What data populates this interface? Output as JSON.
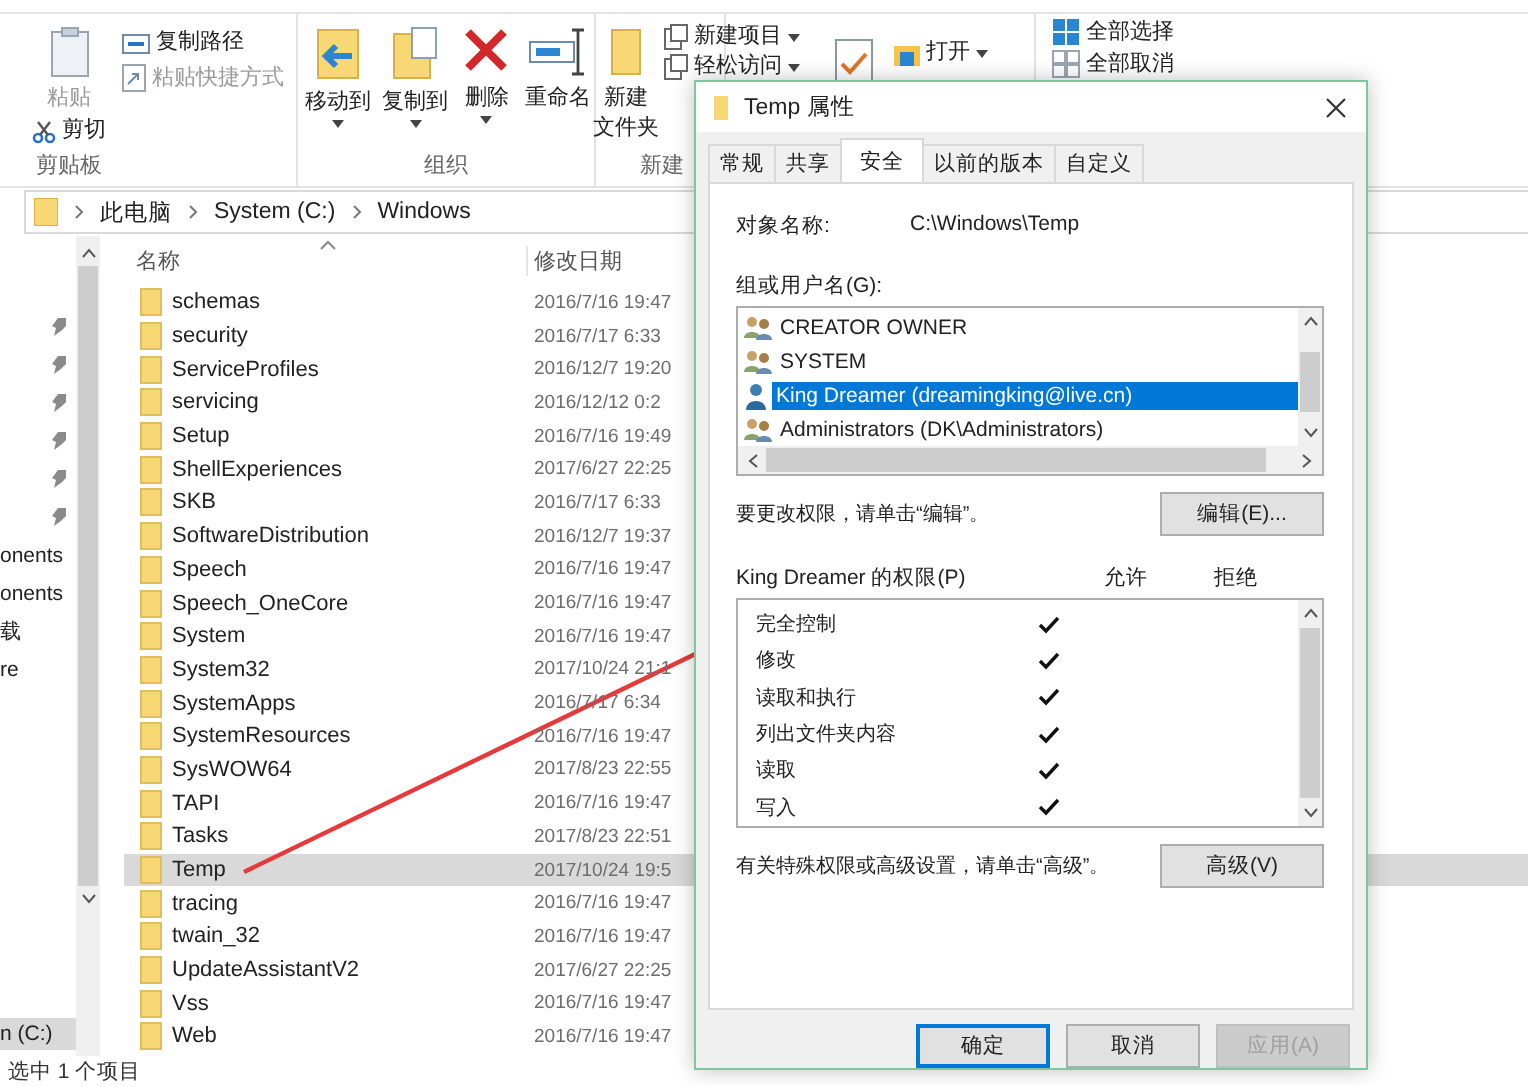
{
  "ribbon": {
    "clipboard": {
      "label": "剪贴板",
      "items": [
        {
          "label": "粘贴",
          "disabled": true
        },
        {
          "label": "剪切",
          "disabled": false
        },
        {
          "label": "复制路径",
          "disabled": false
        },
        {
          "label": "粘贴快捷方式",
          "disabled": true
        }
      ]
    },
    "organize": {
      "label": "组织",
      "items": [
        {
          "label": "移动到",
          "dropdown": true
        },
        {
          "label": "复制到",
          "dropdown": true
        },
        {
          "label": "删除",
          "dropdown": true
        },
        {
          "label": "重命名",
          "dropdown": false
        }
      ]
    },
    "new": {
      "label": "新建",
      "folder": [
        "新建",
        "文件夹"
      ],
      "items": [
        {
          "label": "新建项目"
        },
        {
          "label": "轻松访问"
        }
      ]
    },
    "open": {
      "label": "打开"
    },
    "select": {
      "items": [
        {
          "label": "全部选择"
        },
        {
          "label": "全部取消"
        }
      ]
    }
  },
  "address": {
    "path": [
      "此电脑",
      "System (C:)",
      "Windows"
    ]
  },
  "nav": {
    "items": [
      {
        "kind": "pin"
      },
      {
        "kind": "pin"
      },
      {
        "kind": "pin"
      },
      {
        "kind": "pin"
      },
      {
        "kind": "pin"
      },
      {
        "kind": "pin"
      },
      {
        "kind": "text",
        "label": "onents",
        "selected": false
      },
      {
        "kind": "text",
        "label": "onents",
        "selected": false
      },
      {
        "kind": "text",
        "label": "载",
        "selected": false
      },
      {
        "kind": "text",
        "label": "re",
        "selected": false
      },
      {
        "kind": "text",
        "label": "n (C:)",
        "selected": true
      }
    ]
  },
  "file_list": {
    "columns": [
      "名称",
      "修改日期"
    ],
    "rows": [
      {
        "name": "schemas",
        "modified": "2016/7/16 19:47",
        "selected": false
      },
      {
        "name": "security",
        "modified": "2016/7/17 6:33",
        "selected": false
      },
      {
        "name": "ServiceProfiles",
        "modified": "2016/12/7 19:20",
        "selected": false
      },
      {
        "name": "servicing",
        "modified": "2016/12/12 0:2",
        "selected": false
      },
      {
        "name": "Setup",
        "modified": "2016/7/16 19:49",
        "selected": false
      },
      {
        "name": "ShellExperiences",
        "modified": "2017/6/27 22:25",
        "selected": false
      },
      {
        "name": "SKB",
        "modified": "2016/7/17 6:33",
        "selected": false
      },
      {
        "name": "SoftwareDistribution",
        "modified": "2016/12/7 19:37",
        "selected": false
      },
      {
        "name": "Speech",
        "modified": "2016/7/16 19:47",
        "selected": false
      },
      {
        "name": "Speech_OneCore",
        "modified": "2016/7/16 19:47",
        "selected": false
      },
      {
        "name": "System",
        "modified": "2016/7/16 19:47",
        "selected": false
      },
      {
        "name": "System32",
        "modified": "2017/10/24 21:1",
        "selected": false
      },
      {
        "name": "SystemApps",
        "modified": "2016/7/17 6:34",
        "selected": false
      },
      {
        "name": "SystemResources",
        "modified": "2016/7/16 19:47",
        "selected": false
      },
      {
        "name": "SysWOW64",
        "modified": "2017/8/23 22:55",
        "selected": false
      },
      {
        "name": "TAPI",
        "modified": "2016/7/16 19:47",
        "selected": false
      },
      {
        "name": "Tasks",
        "modified": "2017/8/23 22:51",
        "selected": false
      },
      {
        "name": "Temp",
        "modified": "2017/10/24 19:5",
        "selected": true
      },
      {
        "name": "tracing",
        "modified": "2016/7/16 19:47",
        "selected": false
      },
      {
        "name": "twain_32",
        "modified": "2016/7/16 19:47",
        "selected": false
      },
      {
        "name": "UpdateAssistantV2",
        "modified": "2017/6/27 22:25",
        "selected": false
      },
      {
        "name": "Vss",
        "modified": "2016/7/16 19:47",
        "selected": false
      },
      {
        "name": "Web",
        "modified": "2016/7/16 19:47",
        "selected": false
      }
    ]
  },
  "status_bar": "选中 1 个项目",
  "dialog": {
    "title": "Temp 属性",
    "tabs": [
      {
        "label": "常规",
        "selected": false
      },
      {
        "label": "共享",
        "selected": false
      },
      {
        "label": "安全",
        "selected": true
      },
      {
        "label": "以前的版本",
        "selected": false
      },
      {
        "label": "自定义",
        "selected": false
      }
    ],
    "object_label": "对象名称:",
    "object_name": "C:\\Windows\\Temp",
    "groups_label": "组或用户名(G):",
    "groups": [
      {
        "name": "CREATOR OWNER",
        "kind": "group",
        "selected": false
      },
      {
        "name": "SYSTEM",
        "kind": "group",
        "selected": false
      },
      {
        "name": "King Dreamer (dreamingking@live.cn)",
        "kind": "user",
        "selected": true
      },
      {
        "name": "Administrators (DK\\Administrators)",
        "kind": "group",
        "selected": false
      }
    ],
    "edit_hint": "要更改权限，请单击“编辑”。",
    "edit_button": "编辑(E)...",
    "permissions_label": "King Dreamer 的权限(P)",
    "allow_label": "允许",
    "deny_label": "拒绝",
    "permissions": [
      {
        "name": "完全控制",
        "allow": true,
        "deny": false
      },
      {
        "name": "修改",
        "allow": true,
        "deny": false
      },
      {
        "name": "读取和执行",
        "allow": true,
        "deny": false
      },
      {
        "name": "列出文件夹内容",
        "allow": true,
        "deny": false
      },
      {
        "name": "读取",
        "allow": true,
        "deny": false
      },
      {
        "name": "写入",
        "allow": true,
        "deny": false
      }
    ],
    "advanced_hint": "有关特殊权限或高级设置，请单击“高级”。",
    "advanced_button": "高级(V)",
    "buttons": [
      {
        "label": "确定",
        "kind": "default",
        "disabled": false
      },
      {
        "label": "取消",
        "kind": "normal",
        "disabled": false
      },
      {
        "label": "应用(A)",
        "kind": "normal",
        "disabled": true
      }
    ]
  }
}
